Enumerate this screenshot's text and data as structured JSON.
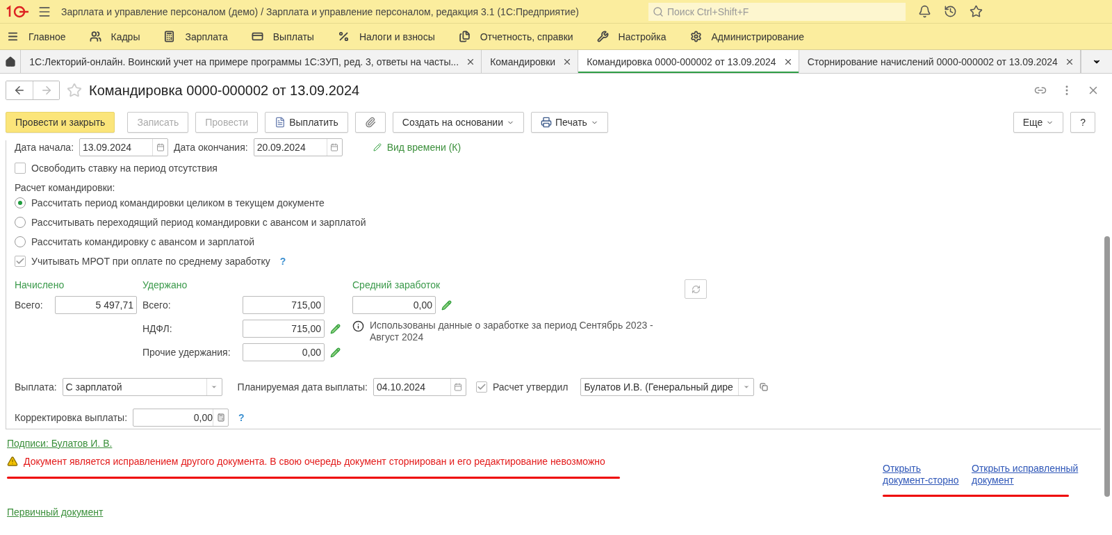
{
  "app_bar": {
    "title": "Зарплата и управление персоналом (демо) / Зарплата и управление персоналом, редакция 3.1  (1С:Предприятие)",
    "search": {
      "placeholder": "Поиск Ctrl+Shift+F"
    }
  },
  "sections": [
    {
      "label": "Главное"
    },
    {
      "label": "Кадры"
    },
    {
      "label": "Зарплата"
    },
    {
      "label": "Выплаты"
    },
    {
      "label": "Налоги и взносы"
    },
    {
      "label": "Отчетность, справки"
    },
    {
      "label": "Настройка"
    },
    {
      "label": "Администрирование"
    }
  ],
  "open_tabs": [
    {
      "label": "1С:Лекторий-онлайн. Воинский учет на примере программы 1С:ЗУП, ред. 3, ответы на часты...",
      "selected": false
    },
    {
      "label": "Командировки",
      "selected": false
    },
    {
      "label": "Командировка 0000-000002 от 13.09.2024",
      "selected": true
    },
    {
      "label": "Сторнирование начислений 0000-000002 от 13.09.2024",
      "selected": false
    }
  ],
  "document": {
    "title": "Командировка 0000-000002 от 13.09.2024",
    "toolbar": [
      {
        "kind": "primary",
        "label": "Провести и закрыть",
        "disabled": false
      },
      {
        "kind": "plain",
        "label": "Записать",
        "disabled": true
      },
      {
        "kind": "plain",
        "label": "Провести",
        "disabled": true
      },
      {
        "kind": "pay",
        "label": "Выплатить",
        "disabled": false
      },
      {
        "kind": "attach",
        "disabled": false
      },
      {
        "kind": "dropdown",
        "label": "Создать на основании",
        "disabled": false
      },
      {
        "kind": "print",
        "label": "Печать",
        "disabled": false
      }
    ],
    "toolbar_right": [
      {
        "kind": "dropdown",
        "label": "Еще",
        "disabled": false
      },
      {
        "kind": "plain",
        "label": "?",
        "disabled": false
      }
    ]
  },
  "form": {
    "dates": [
      {
        "label": "Дата начала:",
        "value": "13.09.2024"
      },
      {
        "label": "Дата окончания:",
        "value": "20.09.2024"
      }
    ],
    "time_kind_link": "Вид времени (К)",
    "free_rate": {
      "label": "Освободить ставку на период отсутствия",
      "checked": false
    },
    "calculation": {
      "label": "Расчет командировки:",
      "options": [
        {
          "label": "Рассчитать период командировки целиком в текущем документе",
          "selected": true
        },
        {
          "label": "Рассчитывать переходящий период командировки с авансом и зарплатой",
          "selected": false
        },
        {
          "label": "Рассчитать командировку с авансом и зарплатой",
          "selected": false
        }
      ]
    },
    "mrot": {
      "label": "Учитывать МРОТ при оплате по среднему заработку",
      "checked": true,
      "help": "?"
    },
    "accrued": {
      "heading": "Начислено",
      "rows": [
        {
          "label": "Всего:",
          "value": "5 497,71",
          "editable": false
        }
      ]
    },
    "withheld": {
      "heading": "Удержано",
      "rows": [
        {
          "label": "Всего:",
          "value": "715,00",
          "editable": false
        },
        {
          "label": "НДФЛ:",
          "value": "715,00",
          "editable": true
        },
        {
          "label": "Прочие удержания:",
          "value": "0,00",
          "editable": true
        }
      ]
    },
    "average": {
      "heading": "Средний заработок",
      "value": "0,00",
      "editable": true,
      "info": "Использованы данные о заработке за период Сентябрь 2023 - Август 2024"
    },
    "payment": {
      "label": "Выплата:",
      "value": "С зарплатой"
    },
    "planned_date": {
      "label": "Планируемая дата выплаты:",
      "value": "04.10.2024"
    },
    "approved": {
      "label": "Расчет утвердил",
      "checked": true,
      "person": "Булатов И.В. (Генеральный дире"
    },
    "correction": {
      "label": "Корректировка выплаты:",
      "value": "0,00",
      "help": "?"
    }
  },
  "signatures_link": "Подписи: Булатов И. В.",
  "warning": "Документ является исправлением другого документа. В свою очередь документ сторнирован и его редактирование невозможно",
  "action_links": [
    {
      "label": "Открыть документ-сторно"
    },
    {
      "label": "Открыть исправленный документ"
    }
  ],
  "primary_link": "Первичный документ"
}
